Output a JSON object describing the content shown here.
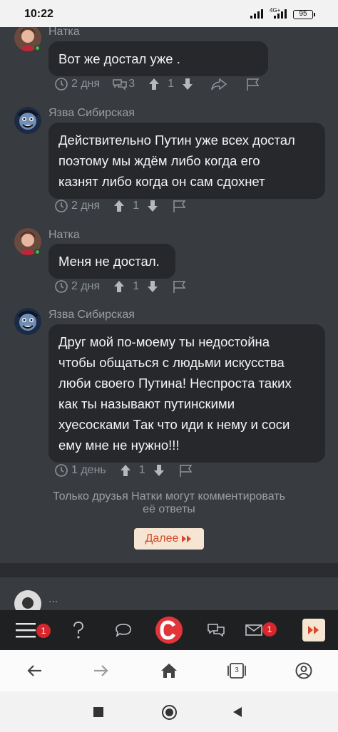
{
  "status_bar": {
    "time": "10:22",
    "network": "4G+",
    "battery": "95"
  },
  "comments": [
    {
      "author": "Натка",
      "text": [
        "Вот же достал уже ."
      ],
      "time": "2 дня",
      "replies": "3",
      "rating": "1"
    },
    {
      "author": "Язва Сибирская",
      "text": [
        "Действительно Путин уже всех достал",
        "поэтому мы ждём либо когда его",
        "казнят либо когда он сам сдохнет"
      ],
      "time": "2 дня",
      "rating": "1"
    },
    {
      "author": "Натка",
      "text": [
        "Меня не достал."
      ],
      "time": "2 дня",
      "rating": "1"
    },
    {
      "author": "Язва Сибирская",
      "text": [
        "Друг мой по-моему ты недостойна",
        "чтобы общаться с людьми искусства",
        "люби своего Путина! Неспроста таких",
        "как ты называют путинскими",
        "хуесосками Так что иди к нему и соси",
        "ему мне не нужно!!!"
      ],
      "time": "1 день",
      "rating": "1"
    }
  ],
  "notice": [
    "Только друзья Натки могут комментировать",
    "её ответы"
  ],
  "more_button": "Далее",
  "next_post_author": "...",
  "bottom_bar": {
    "menu_badge": "1",
    "mail_badge": "1"
  },
  "browser_nav": {
    "tabs_count": "3"
  },
  "colors": {
    "background": "#383b3f",
    "bubble": "#26282b",
    "accent": "#e2353a",
    "button_bg": "#f6e5d2",
    "button_text": "#d34a2a",
    "online": "#3bbf3b"
  }
}
